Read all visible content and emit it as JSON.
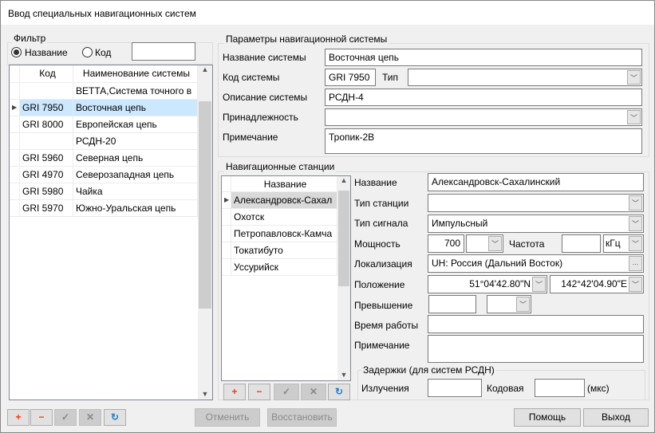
{
  "window": {
    "title": "Ввод специальных навигационных систем"
  },
  "filter": {
    "legend": "Фильтр",
    "radio_name": "Название",
    "radio_code": "Код",
    "selected": "name",
    "input": ""
  },
  "systems_grid": {
    "headers": [
      "Код",
      "Наименование системы"
    ],
    "rows": [
      {
        "code": "",
        "name": "ВЕТТА,Система точного в"
      },
      {
        "code": "GRI 7950",
        "name": "Восточная цепь",
        "selected": true
      },
      {
        "code": "GRI 8000",
        "name": "Европейская цепь"
      },
      {
        "code": "",
        "name": "РСДН-20"
      },
      {
        "code": "GRI 5960",
        "name": "Северная цепь"
      },
      {
        "code": "GRI 4970",
        "name": "Северозападная цепь"
      },
      {
        "code": "GRI 5980",
        "name": "Чайка"
      },
      {
        "code": "GRI 5970",
        "name": "Южно-Уральская цепь"
      }
    ]
  },
  "params": {
    "legend": "Параметры навигационной системы",
    "name_label": "Название системы",
    "name_value": "Восточная цепь",
    "code_label": "Код системы",
    "code_value": "GRI 7950",
    "type_label": "Тип",
    "type_value": "",
    "desc_label": "Описание системы",
    "desc_value": "РСДН-4",
    "belong_label": "Принадлежность",
    "belong_value": "",
    "note_label": "Примечание",
    "note_value": "Тропик-2В"
  },
  "stations": {
    "legend": "Навигационные станции",
    "header": "Название",
    "rows": [
      "Александровск-Сахал",
      "Охотск",
      "Петропавловск-Камча",
      "Токатибуто",
      "Уссурийск"
    ],
    "name_label": "Название",
    "name_value": "Александровск-Сахалинский",
    "station_type_label": "Тип станции",
    "station_type_value": "",
    "signal_type_label": "Тип сигнала",
    "signal_type_value": "Импульсный",
    "power_label": "Мощность",
    "power_value": "700",
    "power_unit": "",
    "freq_label": "Частота",
    "freq_value": "",
    "freq_unit": "кГц",
    "loc_label": "Локализация",
    "loc_value": "UH: Россия (Дальний Восток)",
    "loc_button": "...",
    "pos_label": "Положение",
    "lat": "51°04'42.80\"N",
    "lon": "142°42'04.90\"E",
    "elev_label": "Превышение",
    "elev_value": "",
    "elev_unit": "",
    "work_label": "Время работы",
    "work_value": "",
    "note_label": "Примечание",
    "note_value": "",
    "delays": {
      "legend": "Задержки (для систем РСДН)",
      "emission_label": "Излучения",
      "emission_value": "",
      "code_label": "Кодовая",
      "code_value": "",
      "unit": "(мкс)"
    }
  },
  "toolbar_icons": {
    "add": "+",
    "remove": "−",
    "apply": "✓",
    "cancel": "✕",
    "refresh": "↻"
  },
  "buttons": {
    "cancel": "Отменить",
    "restore": "Восстановить",
    "help": "Помощь",
    "exit": "Выход"
  }
}
